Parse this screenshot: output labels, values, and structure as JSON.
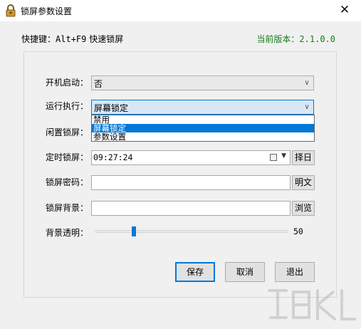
{
  "window": {
    "title": "锁屏参数设置",
    "close_glyph": "✕"
  },
  "header": {
    "hotkey_label": "快捷键：",
    "hotkey_keys": "Alt+F9",
    "hotkey_desc": " 快速锁屏",
    "version_label": "当前版本：",
    "version_value": "2.1.0.0"
  },
  "form": {
    "autostart": {
      "label": "开机启动：",
      "value": "否"
    },
    "run_action": {
      "label": "运行执行：",
      "value": "屏幕锁定",
      "options": [
        "禁用",
        "屏幕锁定",
        "参数设置"
      ],
      "selected_option": "屏幕锁定"
    },
    "idle_lock": {
      "label": "闲置锁屏："
    },
    "timed_lock": {
      "label": "定时锁屏：",
      "value": "09:27:24",
      "select_button": "择日"
    },
    "password": {
      "label": "锁屏密码：",
      "value": "",
      "toggle_button": "明文"
    },
    "background": {
      "label": "锁屏背景：",
      "value": "",
      "browse_button": "浏览"
    },
    "opacity": {
      "label": "背景透明：",
      "value": "50",
      "fraction": 0.2
    }
  },
  "buttons": {
    "save": "保存",
    "cancel": "取消",
    "exit": "退出"
  },
  "colors": {
    "accent": "#0078d7",
    "version_green": "#1a7a1a"
  },
  "icons": {
    "app": "padlock-icon",
    "close": "close-icon",
    "calendar": "calendar-icon",
    "dropdown": "chevron-down-icon"
  }
}
